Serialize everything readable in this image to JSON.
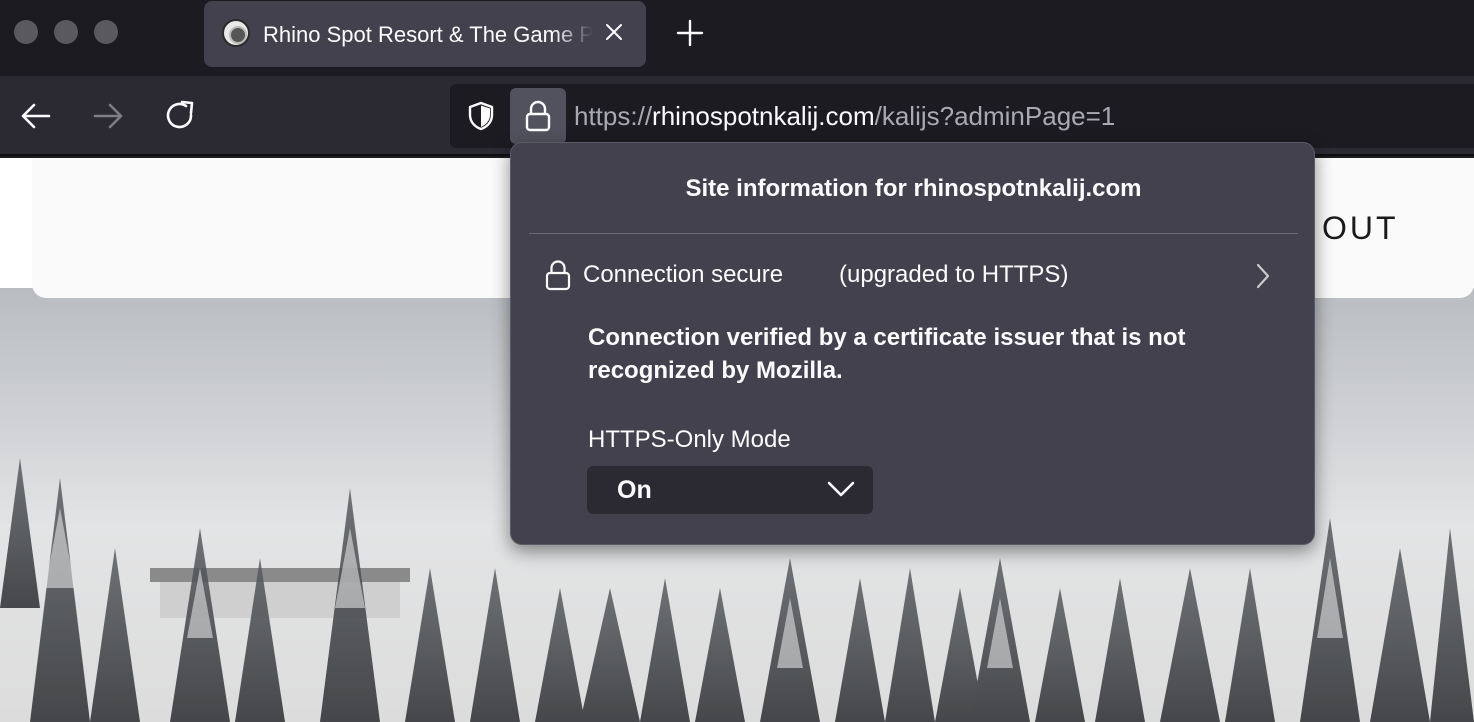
{
  "window": {
    "traffic_lights": [
      "close",
      "minimize",
      "zoom"
    ]
  },
  "tab": {
    "title": "Rhino Spot Resort & The Game Park",
    "favicon": "resort-logo-icon",
    "close_icon": "close-icon"
  },
  "toolbar": {
    "new_tab_icon": "plus-icon",
    "back_icon": "arrow-left-icon",
    "forward_icon": "arrow-right-icon",
    "reload_icon": "reload-icon"
  },
  "urlbar": {
    "scheme": "https://",
    "host": "rhinospotnkalij.com",
    "path": "/kalijs?adminPage=1",
    "shield_icon": "shield-icon",
    "lock_icon": "lock-icon"
  },
  "page": {
    "nav_partial": "OUT"
  },
  "popup": {
    "title": "Site information for rhinospotnkalij.com",
    "connection_label": "Connection secure",
    "connection_sub": "(upgraded to HTTPS)",
    "verified_text": "Connection verified by a certificate issuer that is not recognized by Mozilla.",
    "https_only_label": "HTTPS-Only Mode",
    "https_only_value": "On"
  },
  "colors": {
    "chrome_bg": "#1c1b22",
    "toolbar_bg": "#2b2a33",
    "popup_bg": "#42414d",
    "text": "#fbfbfe"
  }
}
